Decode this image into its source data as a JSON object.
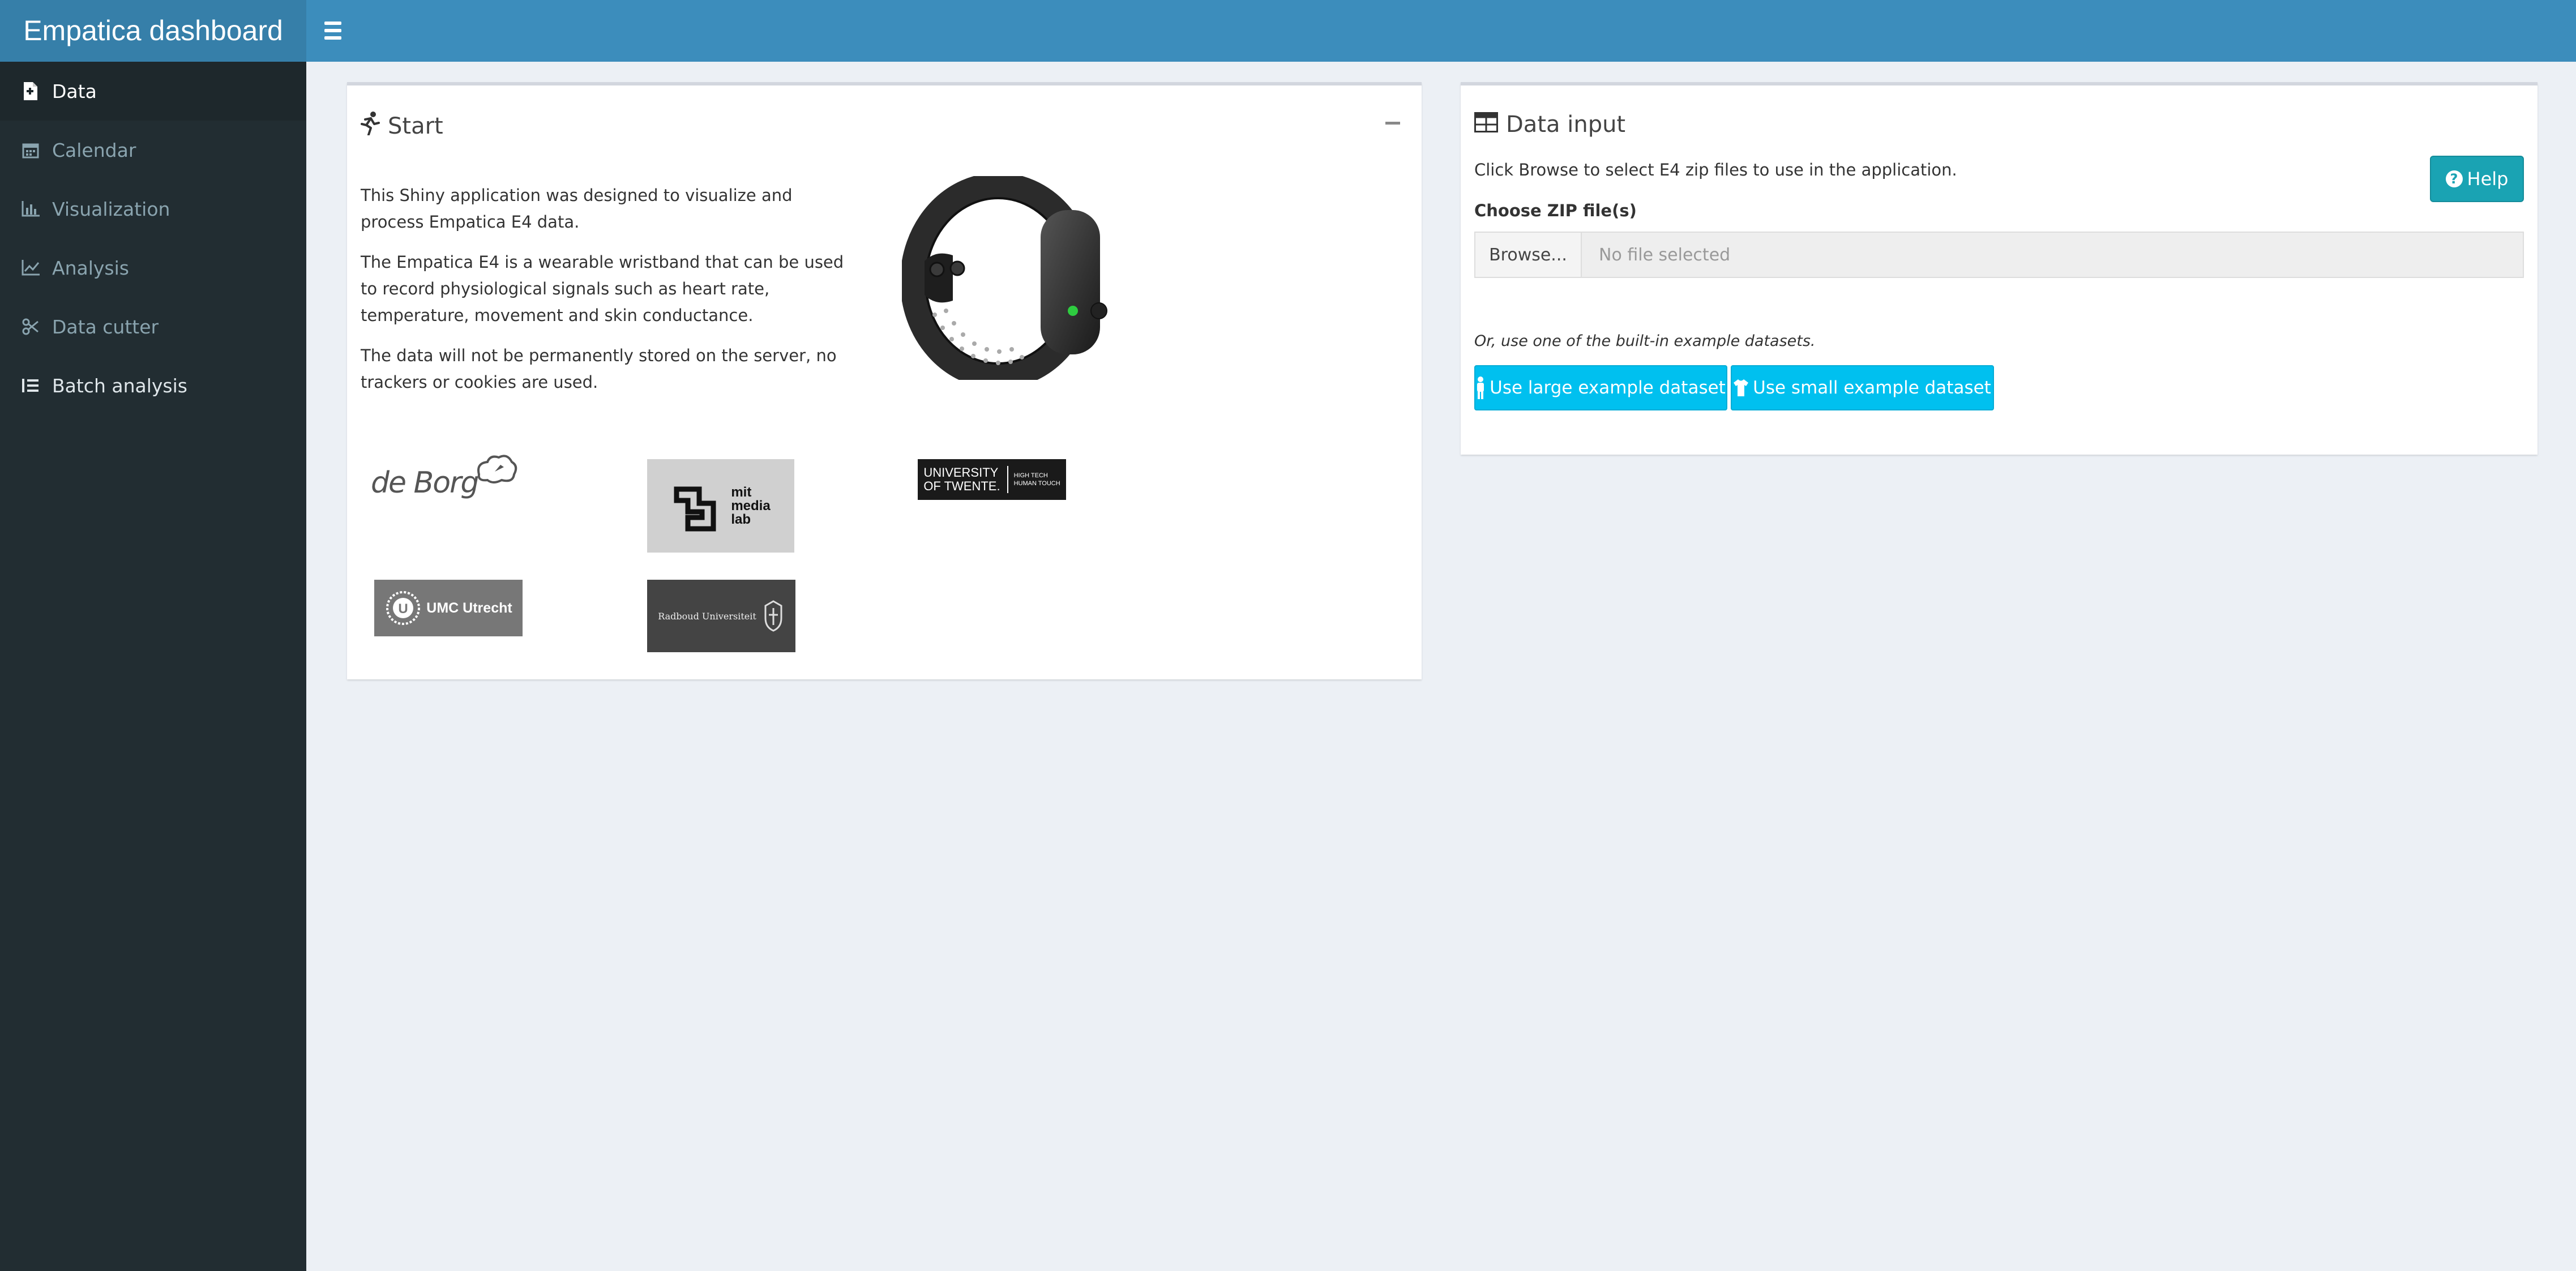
{
  "header": {
    "app_title": "Empatica dashboard"
  },
  "sidebar": {
    "items": [
      {
        "label": "Data",
        "icon": "file-icon"
      },
      {
        "label": "Calendar",
        "icon": "calendar-icon"
      },
      {
        "label": "Visualization",
        "icon": "bar-chart-icon"
      },
      {
        "label": "Analysis",
        "icon": "line-chart-icon"
      },
      {
        "label": "Data cutter",
        "icon": "scissors-icon"
      },
      {
        "label": "Batch analysis",
        "icon": "list-icon"
      }
    ]
  },
  "start_box": {
    "title": "Start",
    "paragraph1": "This Shiny application was designed to visualize and process Empatica E4 data.",
    "paragraph2": "The Empatica E4 is a wearable wristband that can be used to record physiological signals such as heart rate, temperature, movement and skin conductance.",
    "paragraph3": "The data will not be permanently stored on the server, no trackers or cookies are used.",
    "logos": {
      "deborg": "de Borg",
      "mit_line1": "mit",
      "mit_line2": "media",
      "mit_line3": "lab",
      "twente_line1": "UNIVERSITY",
      "twente_line2": "OF TWENTE.",
      "twente_tag1": "HIGH TECH",
      "twente_tag2": "HUMAN TOUCH",
      "umc": "UMC Utrecht",
      "radboud": "Radboud Universiteit"
    }
  },
  "data_input_box": {
    "title": "Data input",
    "instructions": "Click Browse to select E4 zip files to use in the application.",
    "help_label": "Help",
    "file_label": "Choose ZIP file(s)",
    "browse_label": "Browse...",
    "file_placeholder": "No file selected",
    "example_text": "Or, use one of the built-in example datasets.",
    "large_example_label": "Use large example dataset",
    "small_example_label": "Use small example dataset"
  },
  "colors": {
    "navbar": "#3c8dbc",
    "logo_bg": "#367fa9",
    "sidebar_bg": "#222d32",
    "help_button": "#1aa3b3",
    "example_button": "#00c0ef"
  }
}
